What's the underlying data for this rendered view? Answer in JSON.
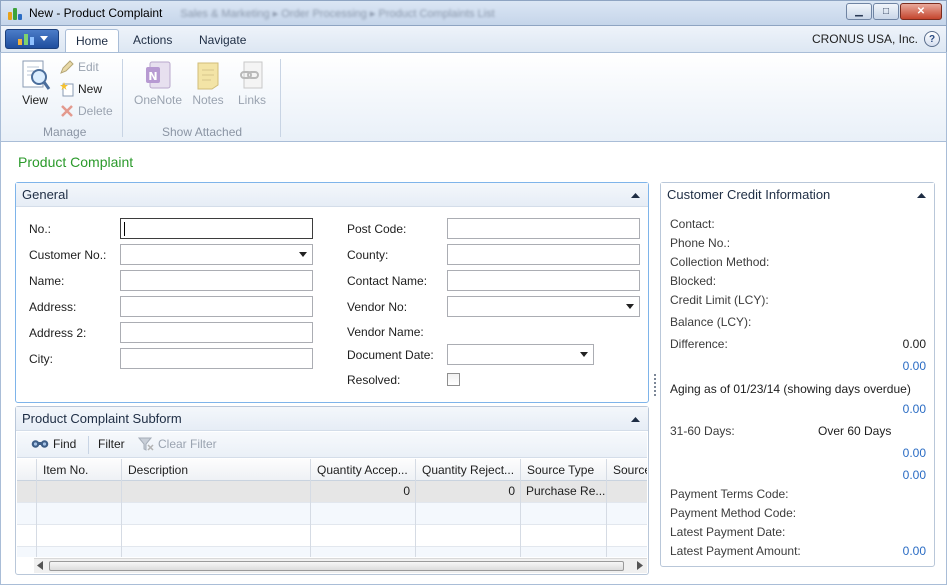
{
  "window": {
    "title": "New - Product Complaint",
    "breadcrumb_blurred": "Sales & Marketing  ▸  Order Processing  ▸  Product Complaints List",
    "minimize": "▁",
    "maximize": "□",
    "close": "✕"
  },
  "ribbon": {
    "tabs": [
      "Home",
      "Actions",
      "Navigate"
    ],
    "company": "CRONUS USA, Inc.",
    "help": "?",
    "manage": {
      "view": "View",
      "edit": "Edit",
      "new": "New",
      "delete": "Delete",
      "group": "Manage"
    },
    "show_attached": {
      "onenote": "OneNote",
      "notes": "Notes",
      "links": "Links",
      "group": "Show Attached"
    }
  },
  "page_title": "Product Complaint",
  "general": {
    "title": "General",
    "left_fields": [
      {
        "label": "No.:",
        "value": ""
      },
      {
        "label": "Customer No.:",
        "value": ""
      },
      {
        "label": "Name:",
        "value": ""
      },
      {
        "label": "Address:",
        "value": ""
      },
      {
        "label": "Address 2:",
        "value": ""
      },
      {
        "label": "City:",
        "value": ""
      }
    ],
    "right_fields": [
      {
        "label": "Post Code:",
        "value": ""
      },
      {
        "label": "County:",
        "value": ""
      },
      {
        "label": "Contact Name:",
        "value": ""
      },
      {
        "label": "Vendor No:",
        "value": ""
      },
      {
        "label": "Vendor Name:",
        "value": ""
      },
      {
        "label": "Document Date:",
        "value": ""
      },
      {
        "label": "Resolved:",
        "value": ""
      }
    ]
  },
  "subform": {
    "title": "Product Complaint Subform",
    "toolbar": {
      "find": "Find",
      "filter": "Filter",
      "clear_filter": "Clear Filter"
    },
    "columns": [
      "Item No.",
      "Description",
      "Quantity Accep...",
      "Quantity Reject...",
      "Source Type",
      "Source"
    ],
    "rows": [
      {
        "item_no": "",
        "description": "",
        "qty_accepted": "0",
        "qty_rejected": "0",
        "source_type": "Purchase Re...",
        "source": ""
      }
    ]
  },
  "factbox": {
    "title": "Customer Credit Information",
    "contact": "Contact:",
    "phone": "Phone No.:",
    "collection": "Collection Method:",
    "blocked": "Blocked:",
    "credit_limit": "Credit Limit (LCY):",
    "balance": "Balance (LCY):",
    "difference": "Difference:",
    "difference_value": "0.00",
    "value_1": "0.00",
    "aging": "Aging as of 01/23/14 (showing days overdue)",
    "value_2": "0.00",
    "days_31_60": "31-60 Days:",
    "over_60": "Over 60 Days",
    "value_3": "0.00",
    "value_4": "0.00",
    "payment_terms": "Payment Terms Code:",
    "payment_method": "Payment Method Code:",
    "latest_payment_date": "Latest Payment Date:",
    "latest_payment_amount": "Latest Payment Amount:",
    "latest_payment_amount_value": "0.00"
  }
}
